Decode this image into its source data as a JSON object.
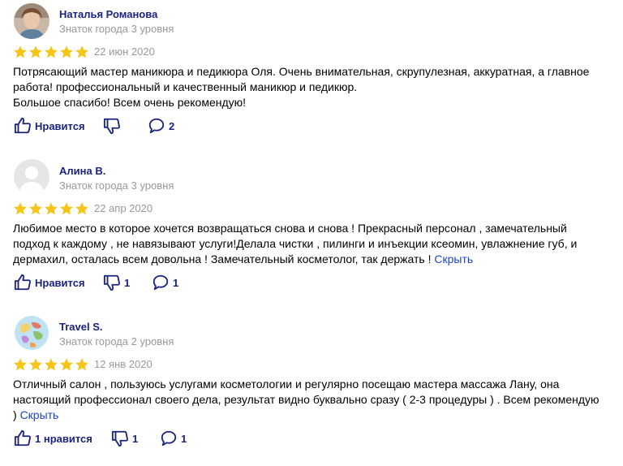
{
  "reviews": [
    {
      "author": "Наталья Романова",
      "level": "Знаток города 3 уровня",
      "rating": 5,
      "date": "22 июн 2020",
      "text_lines": [
        "Потрясающий мастер маникюра и педикюра Оля. Очень внимательная, скрупулезная, аккуратная, а главное",
        "работа! профессиональный и качественный маникюр и педикюр.",
        "Большое спасибо! Всем очень рекомендую!"
      ],
      "like_label": "Нравится",
      "dislike_count": "",
      "comment_count": "2"
    },
    {
      "author": "Алина В.",
      "level": "Знаток города 3 уровня",
      "rating": 5,
      "date": "22 апр 2020",
      "text_lines": [
        "Любимое место в которое хочется возвращаться снова и снова ! Прекрасный персонал , замечательный",
        "подход к каждому , не навязывают услуги!Делала чистки , пилинги и инъекции ксеомин, увлажнение губ, и",
        "дермахил, осталась всем довольна ! Замечательный косметолог, так держать !"
      ],
      "hide_label": "Скрыть",
      "like_label": "Нравится",
      "dislike_count": "1",
      "comment_count": "1"
    },
    {
      "author": "Travel S.",
      "level": "Знаток города 2 уровня",
      "rating": 5,
      "date": "12 янв 2020",
      "text_lines": [
        "Отличный салон , пользуюсь услугами косметологии и регулярно посещаю мастера массажа Лану, она",
        "настоящий профессионал своего дела, результат видно буквально сразу ( 2-3 процедуры ) . Всем рекомендую",
        ")"
      ],
      "hide_label": "Скрыть",
      "like_label": "1 нравится",
      "dislike_count": "1",
      "comment_count": "1"
    }
  ],
  "colors": {
    "star": "#f5c518",
    "name": "#1a237e",
    "muted": "#999999",
    "link": "#1a44c8"
  },
  "icons": {
    "like": "thumbs-up-icon",
    "dislike": "thumbs-down-icon",
    "comment": "comment-bubble-icon",
    "star": "star-icon"
  }
}
